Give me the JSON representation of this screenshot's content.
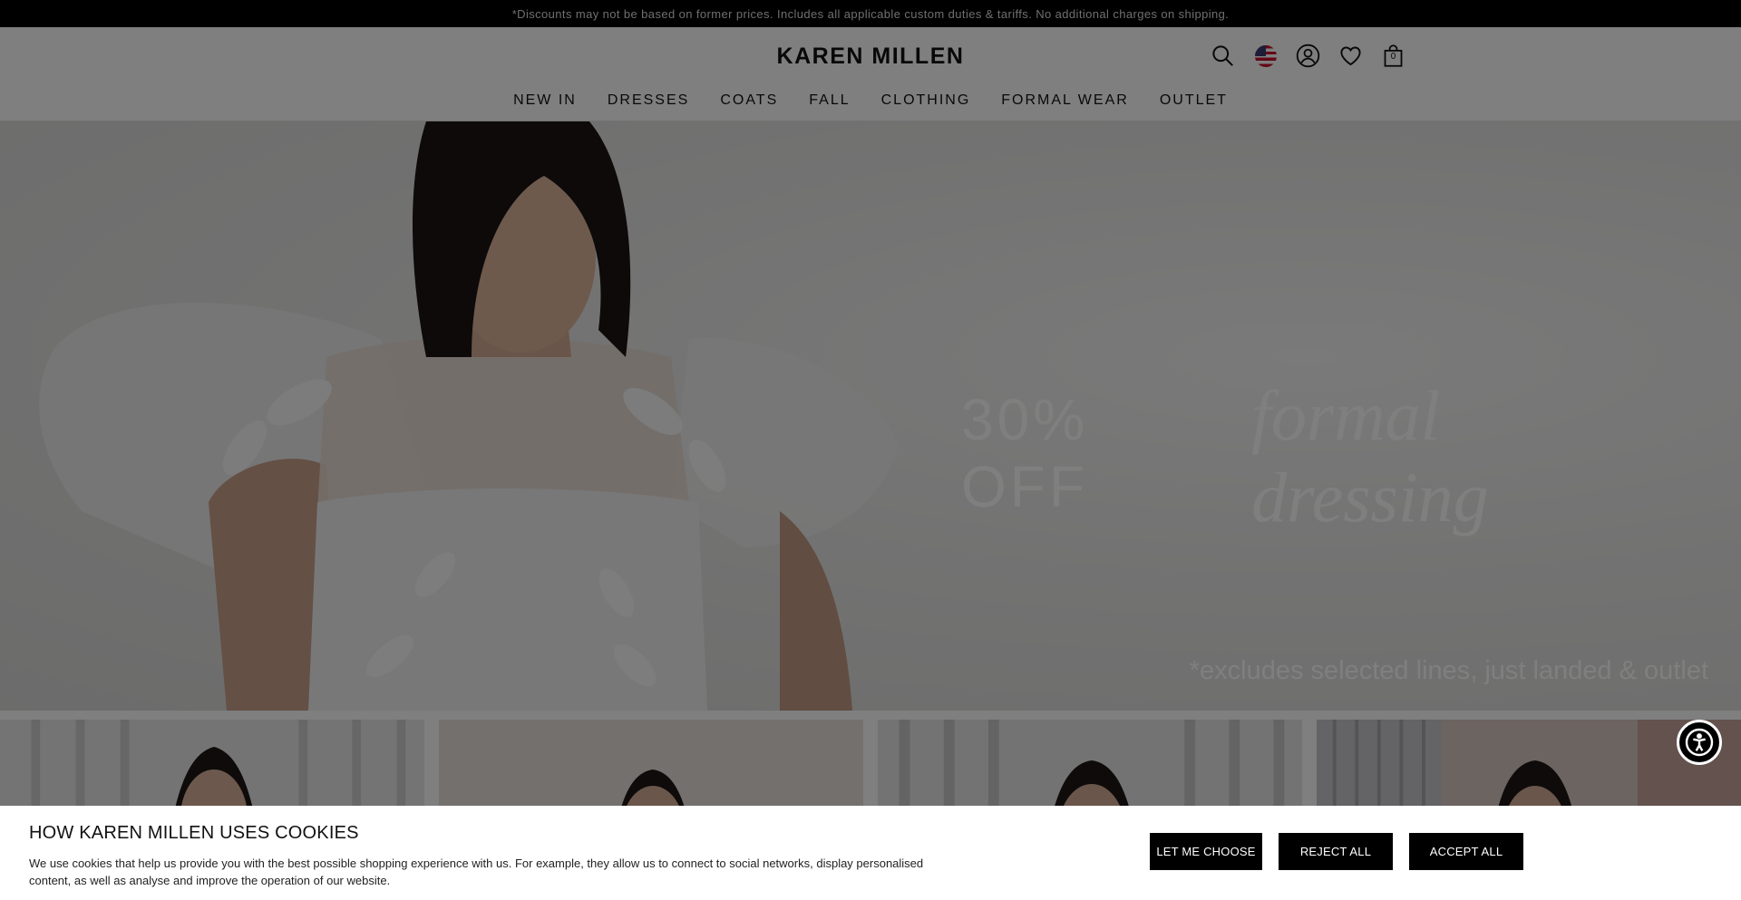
{
  "promo_bar": {
    "text": "*Discounts may not be based on former prices. Includes all applicable custom duties & tariffs. No additional charges on shipping."
  },
  "header": {
    "logo": "KAREN MILLEN",
    "bag_count": "0",
    "icons": [
      "search-icon",
      "us-flag-icon",
      "account-icon",
      "wishlist-heart-icon",
      "shopping-bag-icon"
    ]
  },
  "nav": {
    "items": [
      {
        "label": "NEW IN"
      },
      {
        "label": "DRESSES"
      },
      {
        "label": "COATS"
      },
      {
        "label": "FALL"
      },
      {
        "label": "CLOTHING"
      },
      {
        "label": "FORMAL WEAR"
      },
      {
        "label": "OUTLET"
      }
    ]
  },
  "hero": {
    "headline_main": "30% OFF",
    "headline_script": "formal dressing",
    "note": "*excludes selected lines, just landed & outlet"
  },
  "cookie_banner": {
    "title": "HOW KAREN MILLEN USES COOKIES",
    "text": "We use cookies that help us provide you with the best possible shopping experience with us. For example, they allow us to connect to social networks, display personalised content, as well as analyse and improve the operation of our website.",
    "buttons": {
      "choose": "LET ME CHOOSE",
      "reject": "REJECT ALL",
      "accept": "ACCEPT ALL"
    }
  },
  "colors": {
    "promo_bg": "#000000",
    "overlay": "rgba(0,0,0,0.5)",
    "button_bg": "#000000",
    "button_text": "#ffffff"
  }
}
